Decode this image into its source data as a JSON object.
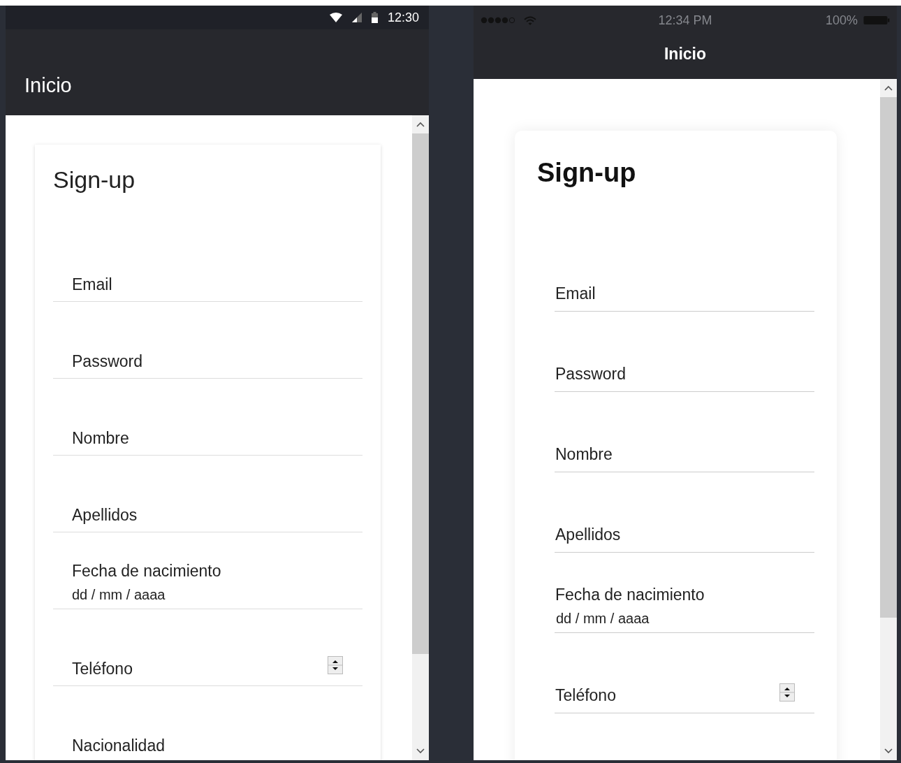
{
  "screens": [
    {
      "kind": "android",
      "status_bar": {
        "time": "12:30"
      },
      "app_bar": {
        "title": "Inicio"
      },
      "form": {
        "title": "Sign-up",
        "fields": [
          {
            "kind": "text",
            "label": "Email"
          },
          {
            "kind": "text",
            "label": "Password"
          },
          {
            "kind": "text",
            "label": "Nombre"
          },
          {
            "kind": "text",
            "label": "Apellidos"
          },
          {
            "kind": "date",
            "label": "Fecha de nacimiento",
            "placeholder": "dd / mm / aaaa"
          },
          {
            "kind": "number",
            "label": "Teléfono"
          },
          {
            "kind": "text",
            "label": "Nacionalidad"
          }
        ]
      }
    },
    {
      "kind": "ios",
      "status_bar": {
        "time": "12:34 PM",
        "battery": "100%"
      },
      "app_bar": {
        "title": "Inicio"
      },
      "form": {
        "title": "Sign-up",
        "fields": [
          {
            "kind": "text",
            "label": "Email"
          },
          {
            "kind": "text",
            "label": "Password"
          },
          {
            "kind": "text",
            "label": "Nombre"
          },
          {
            "kind": "text",
            "label": "Apellidos"
          },
          {
            "kind": "date",
            "label": "Fecha de nacimiento",
            "placeholder": "dd / mm / aaaa"
          },
          {
            "kind": "number",
            "label": "Teléfono"
          }
        ]
      }
    }
  ]
}
